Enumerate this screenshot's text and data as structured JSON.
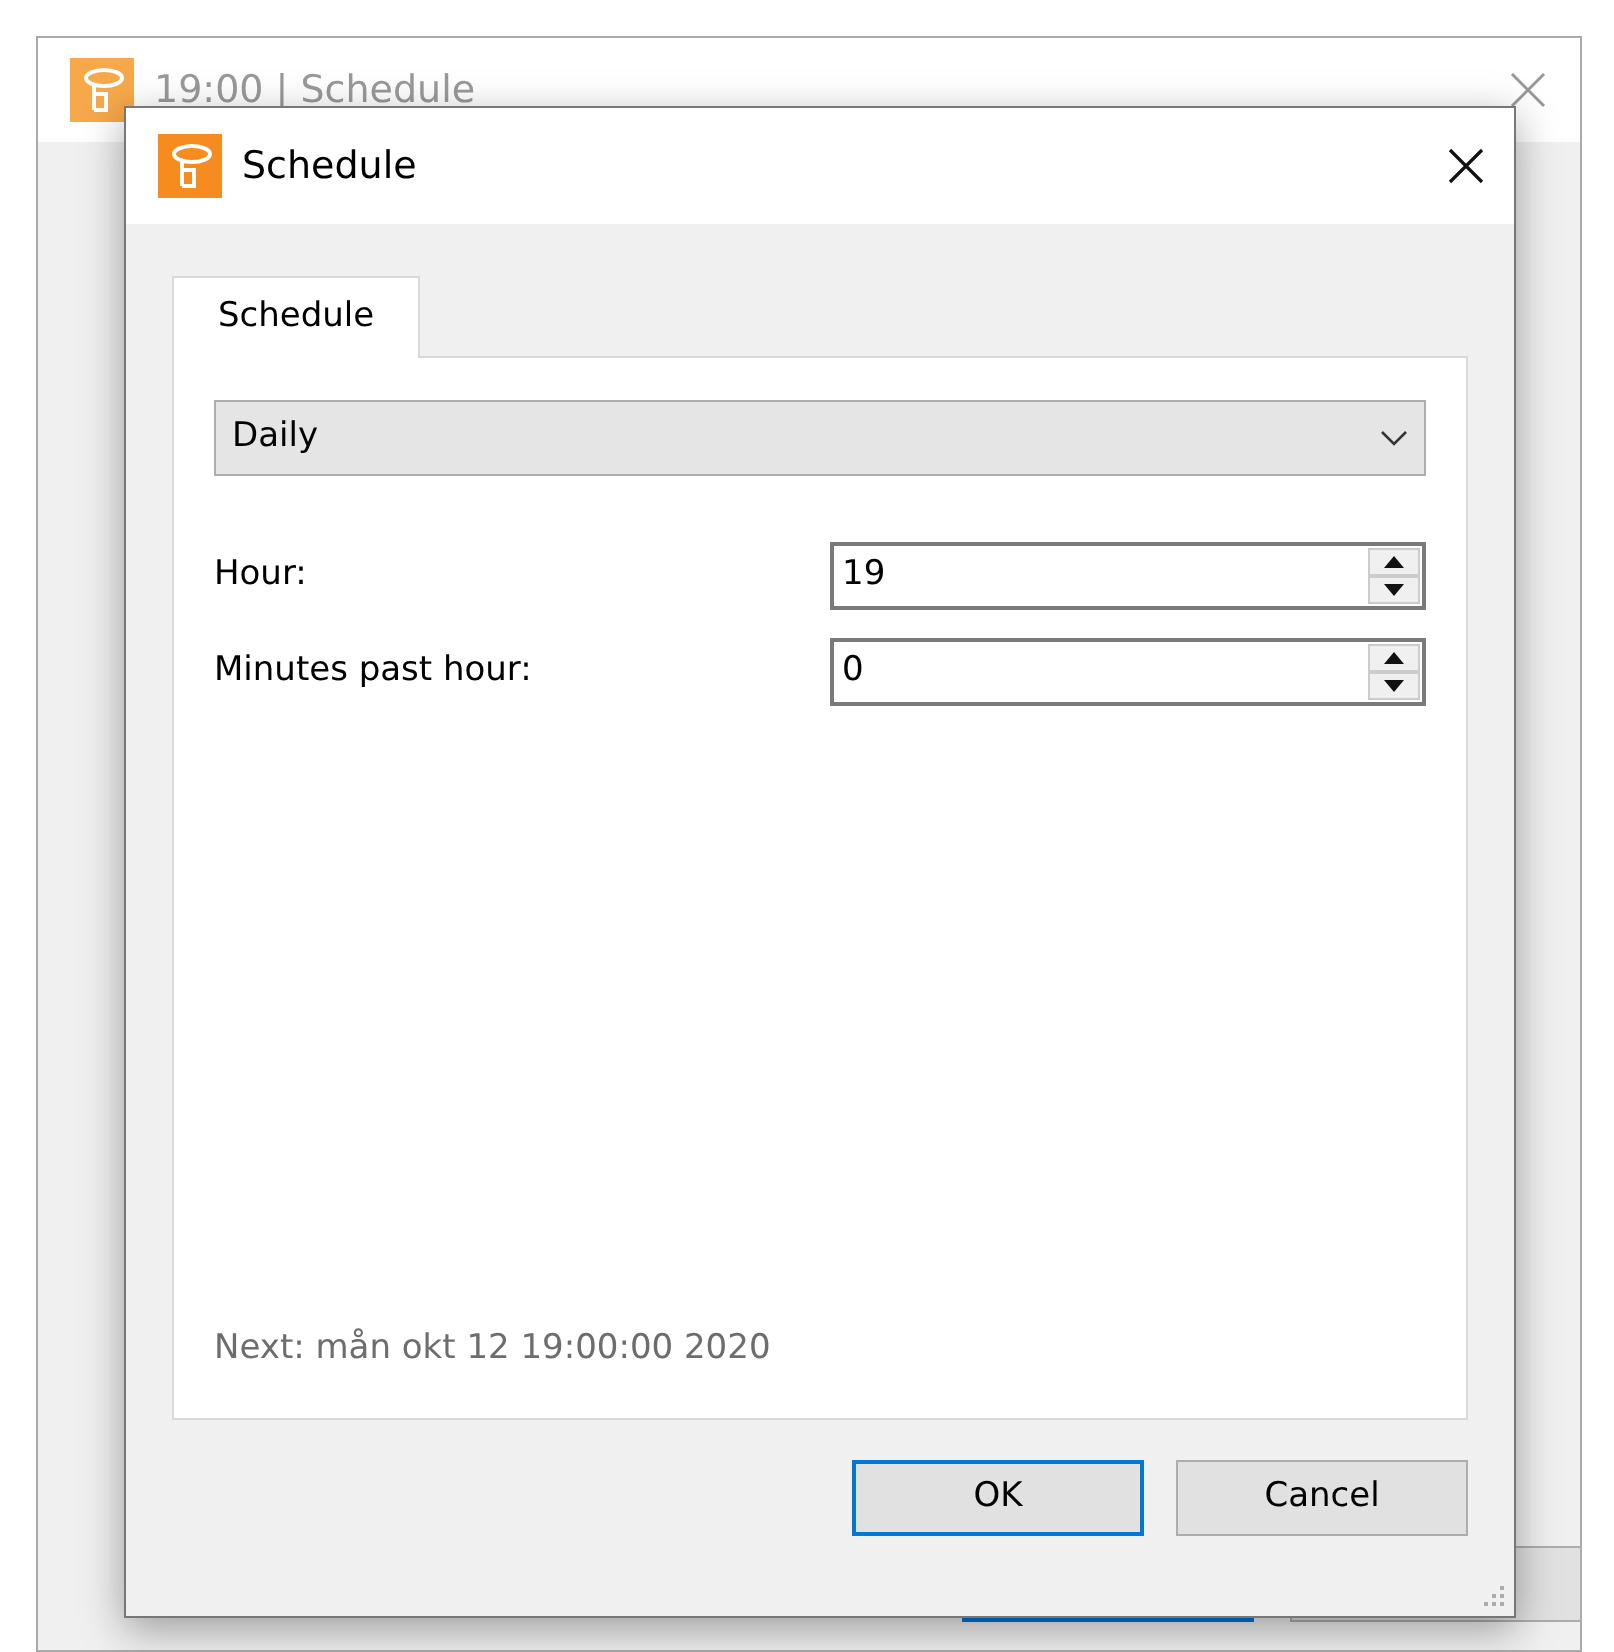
{
  "background_window": {
    "title": "19:00 | Schedule"
  },
  "dialog": {
    "title": "Schedule",
    "tabs": [
      {
        "label": "Schedule",
        "selected": true
      }
    ],
    "frequency": {
      "value": "Daily"
    },
    "fields": [
      {
        "label": "Hour:",
        "value": "19"
      },
      {
        "label": "Minutes past hour:",
        "value": "0"
      }
    ],
    "next_run": "Next: mån okt 12 19:00:00 2020",
    "buttons": [
      {
        "label": "OK",
        "default": true
      },
      {
        "label": "Cancel",
        "default": false
      }
    ]
  }
}
